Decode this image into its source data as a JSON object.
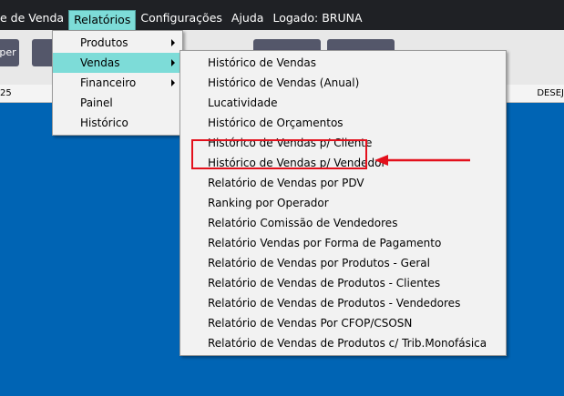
{
  "menubar": {
    "items": [
      "e de Venda",
      "Relatórios",
      "Configurações",
      "Ajuda",
      "Logado: BRUNA"
    ]
  },
  "toolbar": {
    "buttons": [
      "per",
      "",
      "",
      "",
      ""
    ]
  },
  "statusbar": {
    "left": "25",
    "right": "DESEJ"
  },
  "menu_relatorios": {
    "items": [
      {
        "label": "Produtos",
        "submenu": true
      },
      {
        "label": "Vendas",
        "submenu": true
      },
      {
        "label": "Financeiro",
        "submenu": true
      },
      {
        "label": "Painel",
        "submenu": false
      },
      {
        "label": "Histórico",
        "submenu": false
      }
    ]
  },
  "menu_vendas": {
    "items": [
      "Histórico de Vendas",
      "Histórico de Vendas (Anual)",
      "Lucatividade",
      "Histórico de Orçamentos",
      "Histórico de Vendas p/ Cliente",
      "Histórico de Vendas p/ Vendedor",
      "Relatório de Vendas por PDV",
      "Ranking por Operador",
      "Relatório Comissão de  Vendedores",
      "Relatório Vendas por Forma de Pagamento",
      "Relatório de Vendas por Produtos - Geral",
      "Relatório de Vendas de Produtos - Clientes",
      "Relatório de Vendas de Produtos - Vendedores",
      "Relatório de Vendas Por CFOP/CSOSN",
      "Relatório de Vendas de Produtos c/ Trib.Monofásica"
    ]
  },
  "colors": {
    "menubar_bg": "#1f2125",
    "highlight": "#7ddcd8",
    "workspace": "#0064b4",
    "annotation": "#e3101c"
  }
}
